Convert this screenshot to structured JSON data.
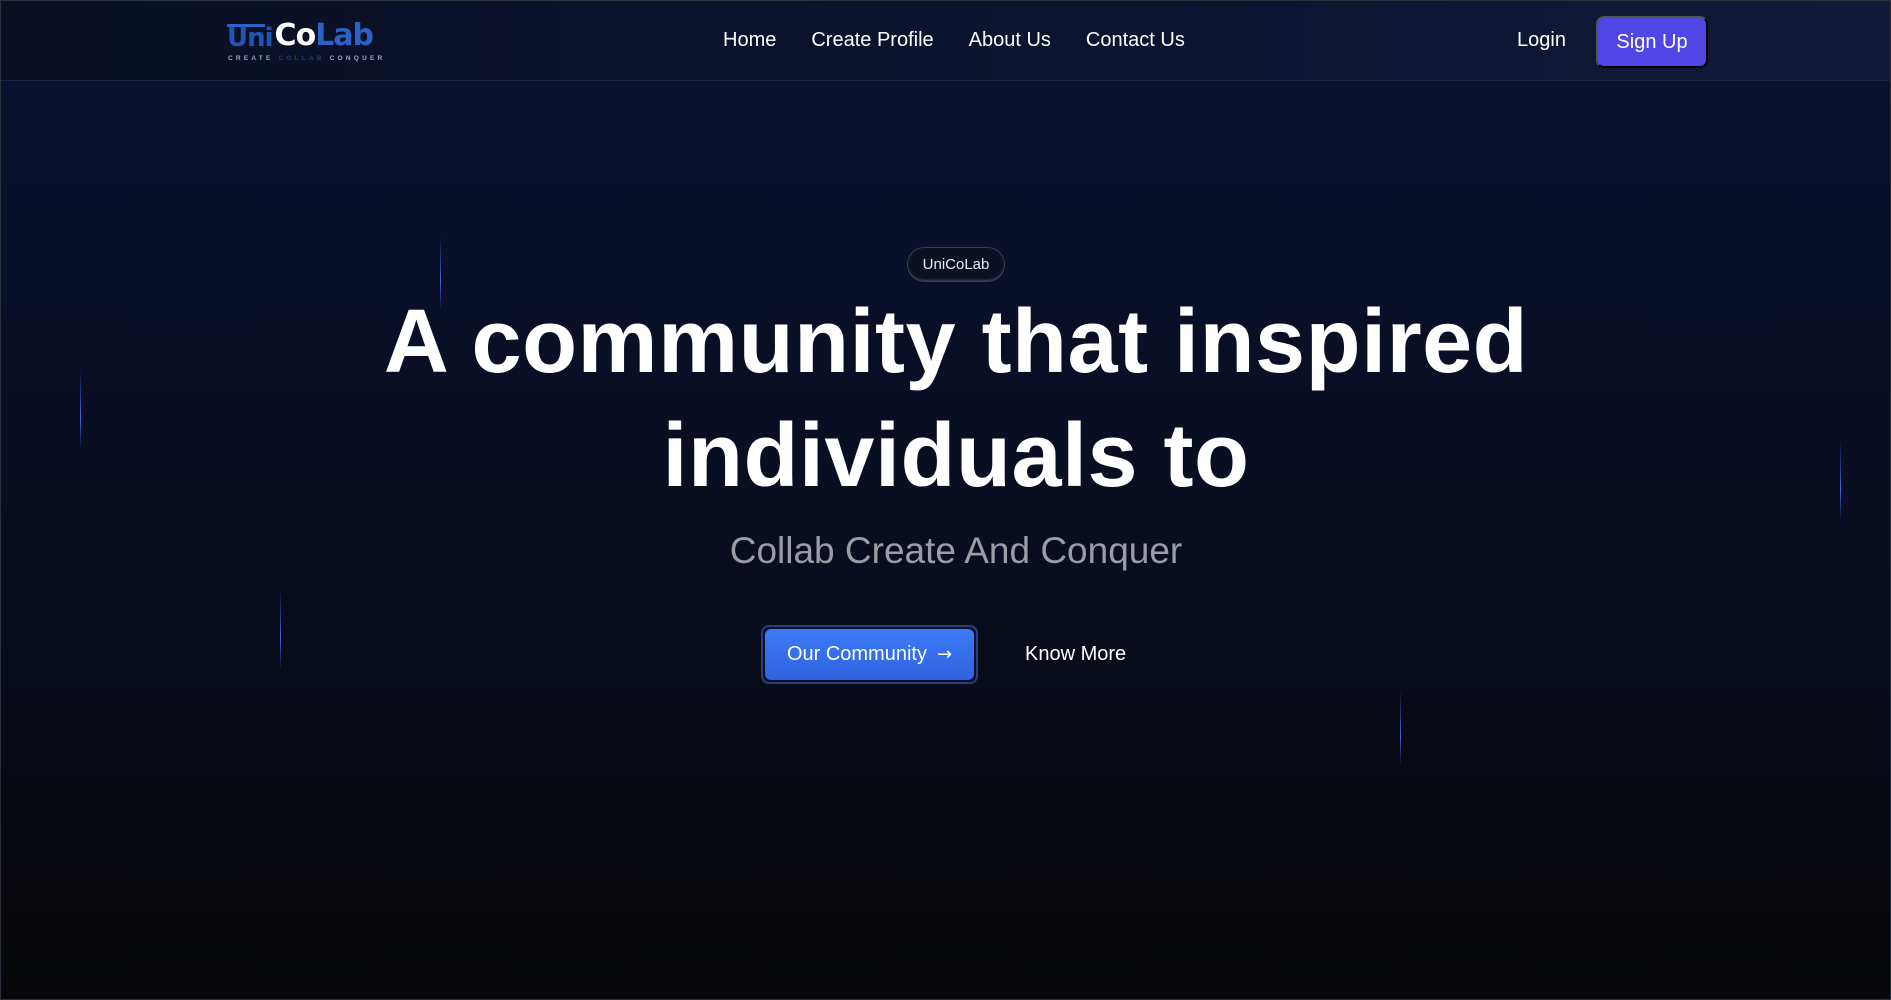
{
  "brand": {
    "logo_parts": {
      "uni": "Uni",
      "co": "Co",
      "lab": "Lab"
    },
    "tagline_parts": {
      "create": "CREATE",
      "collab": "COLLAB",
      "conquer": "CONQUER"
    }
  },
  "nav": {
    "items": [
      {
        "label": "Home"
      },
      {
        "label": "Create Profile"
      },
      {
        "label": "About Us"
      },
      {
        "label": "Contact Us"
      }
    ]
  },
  "auth": {
    "login_label": "Login",
    "signup_label": "Sign Up"
  },
  "hero": {
    "badge": "UniCoLab",
    "headline_line1": "A community that inspired",
    "headline_line2": "individuals to",
    "subheadline": "Collab Create And Conquer",
    "primary_cta": "Our Community",
    "secondary_cta": "Know More"
  },
  "icons": {
    "cta_arrow": "arrow-right-icon"
  },
  "colors": {
    "signup_bg": "#4f46e5",
    "primary_cta": "#3b7bf6",
    "brand_blue": "#2a63c8",
    "page_bg_top": "#0b1230",
    "page_bg_bottom": "#070709"
  }
}
